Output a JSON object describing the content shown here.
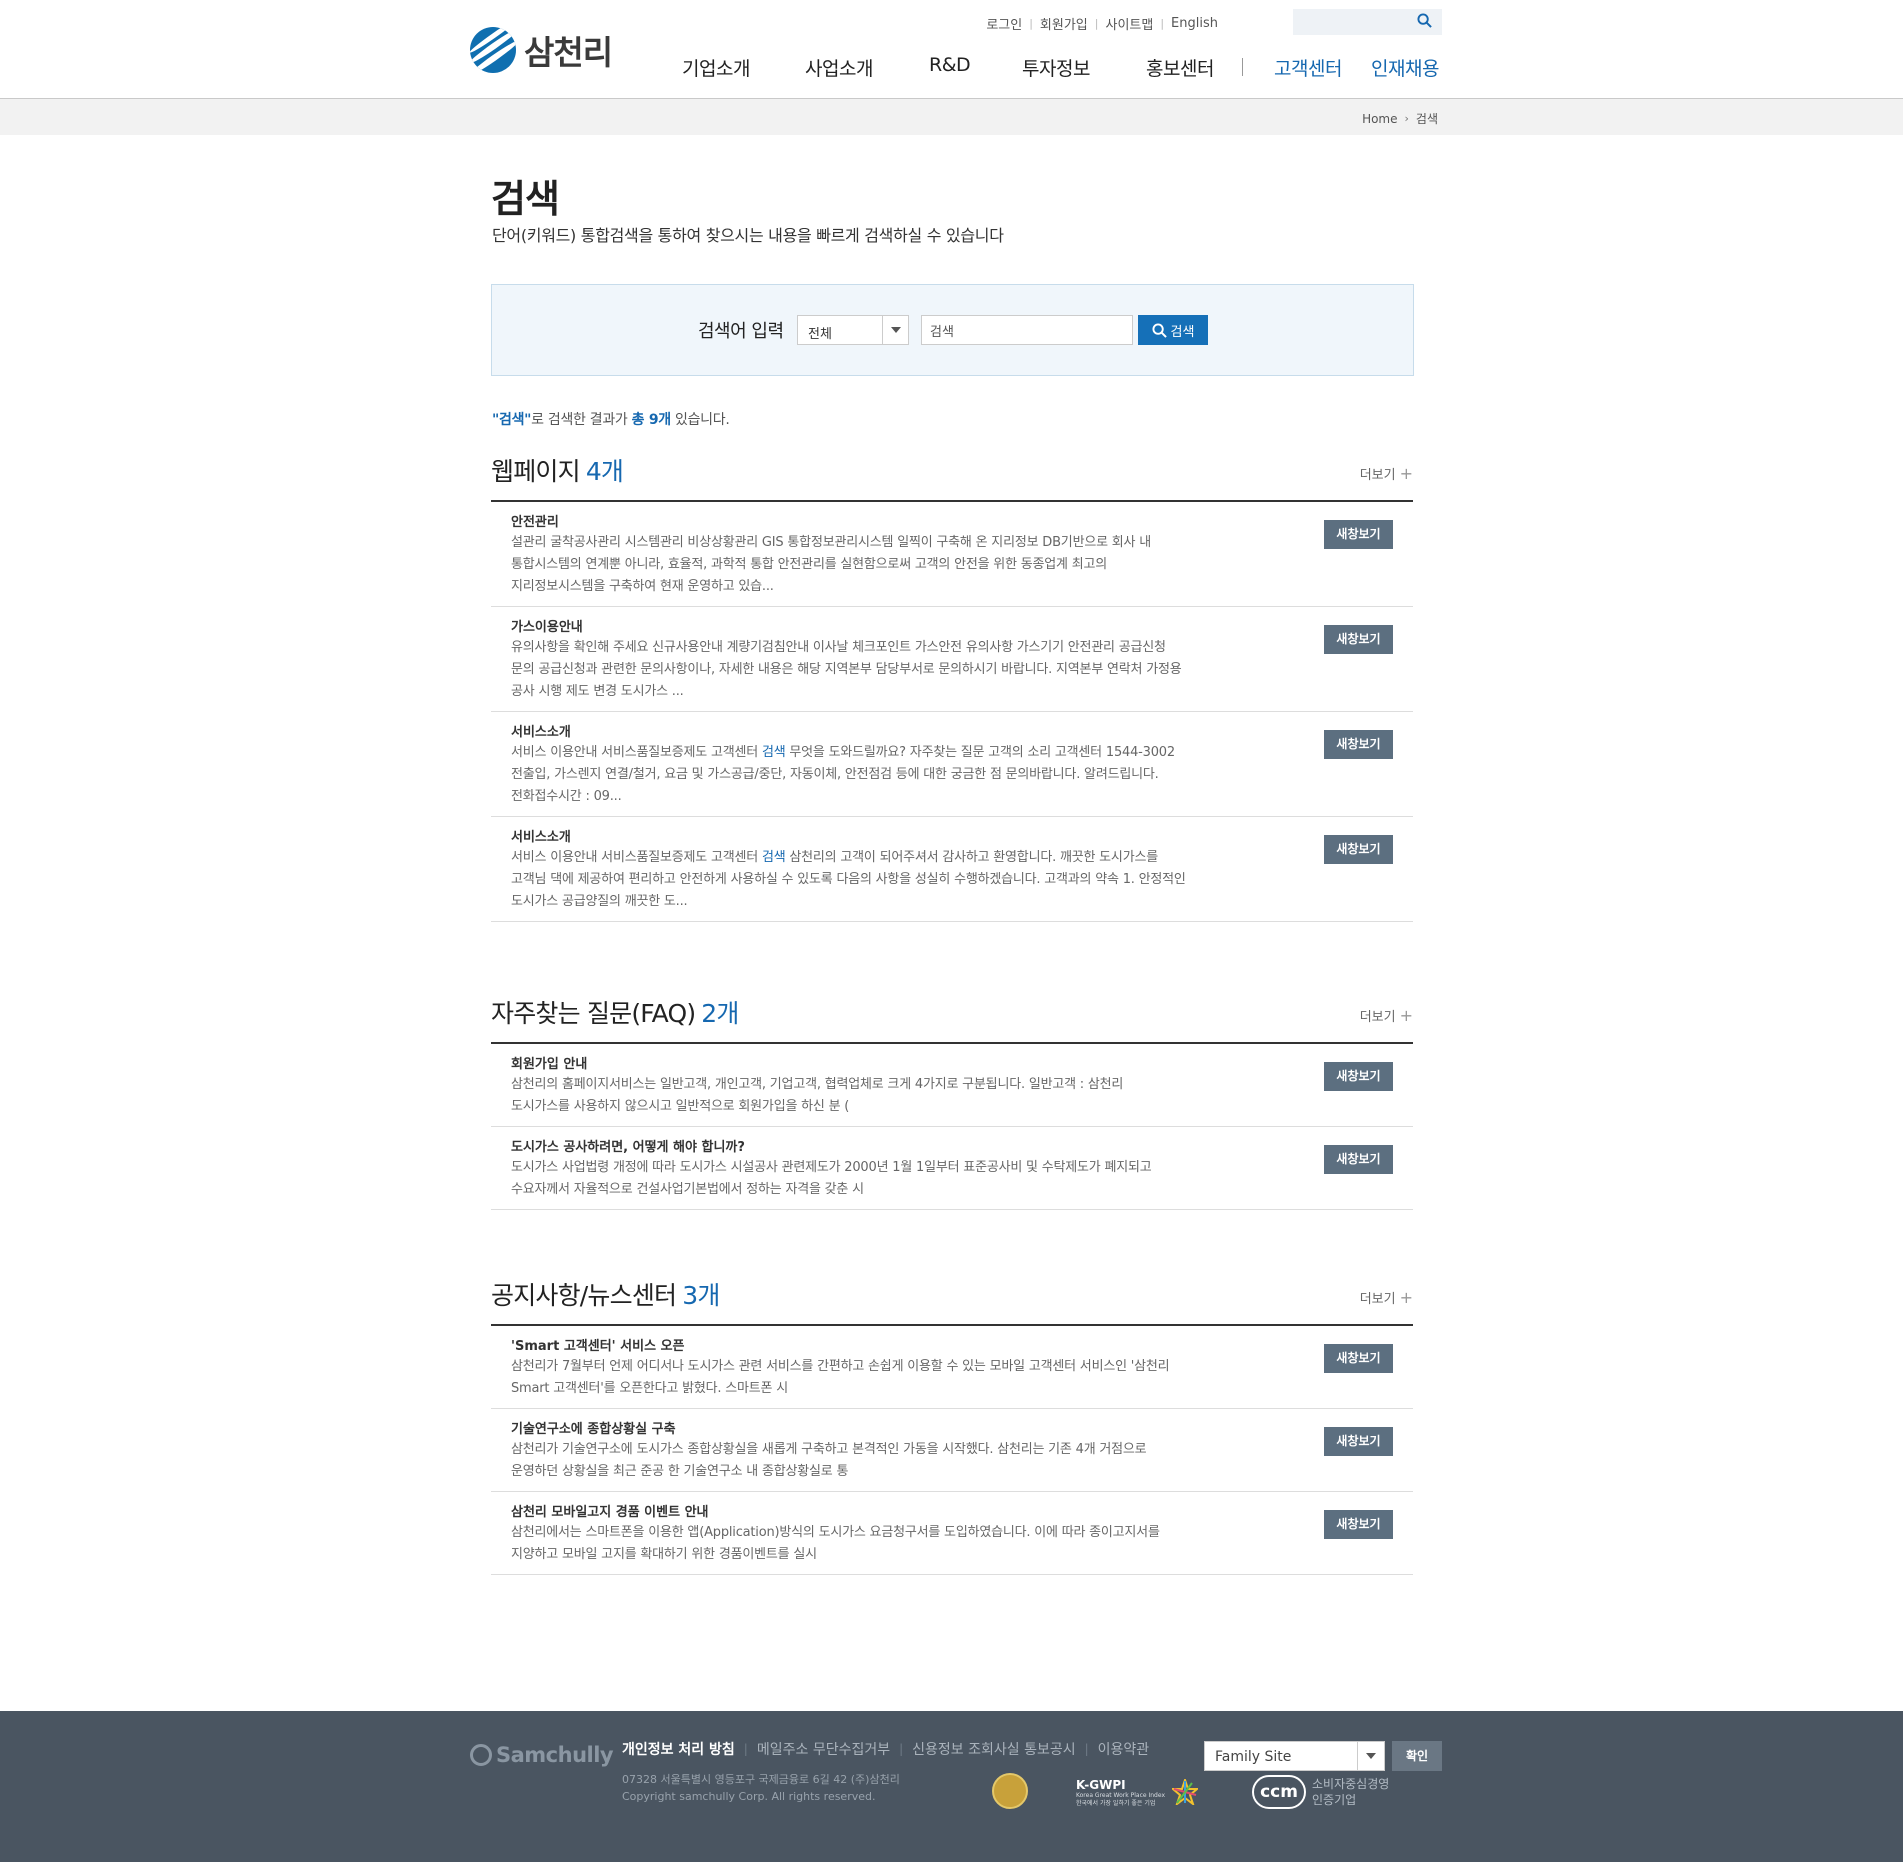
{
  "header": {
    "logo_text": "삼천리",
    "util_links": [
      "로그인",
      "회원가입",
      "사이트맵",
      "English"
    ],
    "gnb": [
      "기업소개",
      "사업소개",
      "R&D",
      "투자정보",
      "홍보센터",
      "고객센터",
      "인재채용"
    ]
  },
  "breadcrumb": {
    "home": "Home",
    "current": "검색"
  },
  "page": {
    "title": "검색",
    "description": "단어(키워드) 통합검색을 통하여 찾으시는 내용을 빠르게 검색하실 수 있습니다"
  },
  "search": {
    "label": "검색어 입력",
    "select_value": "전체",
    "input_value": "검색",
    "button_label": "검색"
  },
  "summary": {
    "keyword": "\"검색\"",
    "text1": "로 검색한 결과가 ",
    "total": "총 9개",
    "text2": " 있습니다."
  },
  "more_label": "더보기",
  "new_window_label": "새창보기",
  "sections": [
    {
      "title": "웹페이지",
      "count": "4개",
      "items": [
        {
          "title": "안전관리",
          "lines": [
            [
              "설관리 굴착공사관리 시스템관리 비상상황관리 GIS 통합정보관리시스템 일찍이 구축해 온 지리정보 DB기반으로 회사 내"
            ],
            [
              "통합시스템의 연계뿐 아니라, 효율적, 과학적 통합 안전관리를 실현함으로써 고객의 안전을 위한 동종업계 최고의"
            ],
            [
              "지리정보시스템을 구축하여 현재 운영하고 있습..."
            ]
          ]
        },
        {
          "title": "가스이용안내",
          "lines": [
            [
              "유의사항을 확인해 주세요 신규사용안내 계량기검침안내 이사날 체크포인트 가스안전 유의사항 가스기기 안전관리 공급신청"
            ],
            [
              "문의 공급신청과 관련한 문의사항이나, 자세한 내용은 해당 지역본부 담당부서로 문의하시기 바랍니다. 지역본부 연락처 가정용"
            ],
            [
              "공사 시행 제도 변경 도시가스 ..."
            ]
          ]
        },
        {
          "title": "서비스소개",
          "lines": [
            [
              "서비스 이용안내 서비스품질보증제도 고객센터 ",
              "검색",
              " 무엇을 도와드릴까요? 자주찾는 질문 고객의 소리 고객센터 1544-3002"
            ],
            [
              "전출입, 가스렌지 연결/철거, 요금 및 가스공급/중단, 자동이체, 안전점검 등에 대한 궁금한 점 문의바랍니다. 알려드립니다."
            ],
            [
              "전화접수시간 : 09..."
            ]
          ]
        },
        {
          "title": "서비스소개",
          "lines": [
            [
              "서비스 이용안내 서비스품질보증제도 고객센터 ",
              "검색",
              " 삼천리의 고객이 되어주셔서 감사하고 환영합니다. 깨끗한 도시가스를"
            ],
            [
              "고객님 댁에 제공하여 편리하고 안전하게 사용하실 수 있도록 다음의 사항을 성실히 수행하겠습니다. 고객과의 약속 1. 안정적인"
            ],
            [
              "도시가스 공급양질의 깨끗한 도..."
            ]
          ]
        }
      ]
    },
    {
      "title": "자주찾는 질문(FAQ)",
      "count": "2개",
      "items": [
        {
          "title": "회원가입 안내",
          "lines": [
            [
              "삼천리의 홈페이지서비스는 일반고객, 개인고객, 기업고객, 협력업체로 크게 4가지로 구분됩니다.   일반고객 : 삼천리"
            ],
            [
              "도시가스를 사용하지 않으시고 일반적으로 회원가입을 하신 분 ("
            ]
          ]
        },
        {
          "title": "도시가스 공사하려면, 어떻게 해야 합니까?",
          "lines": [
            [
              "도시가스 사업법령 개정에 따라 도시가스 시설공사 관련제도가 2000년 1월 1일부터 표준공사비 및 수탁제도가 폐지되고"
            ],
            [
              "수요자께서 자율적으로 건설사업기본법에서 정하는 자격을 갖춘 시"
            ]
          ]
        }
      ]
    },
    {
      "title": "공지사항/뉴스센터",
      "count": "3개",
      "items": [
        {
          "title": "'Smart 고객센터' 서비스 오픈",
          "lines": [
            [
              "삼천리가 7월부터 언제 어디서나 도시가스 관련 서비스를 간편하고 손쉽게 이용할 수 있는 모바일 고객센터 서비스인 '삼천리"
            ],
            [
              "Smart 고객센터'를 오픈한다고 밝혔다.   스마트폰 시"
            ]
          ]
        },
        {
          "title": "기술연구소에 종합상황실 구축",
          "lines": [
            [
              "삼천리가 기술연구소에 도시가스 종합상황실을 새롭게 구축하고 본격적인 가동을 시작했다.   삼천리는 기존 4개 거점으로"
            ],
            [
              "운영하던 상황실을 최근 준공 한 기술연구소 내 종합상황실로 통"
            ]
          ]
        },
        {
          "title": "삼천리 모바일고지 경품 이벤트 안내",
          "lines": [
            [
              "삼천리에서는 스마트폰을 이용한 앱(Application)방식의 도시가스 요금청구서를 도입하였습니다. 이에 따라 종이고지서를"
            ],
            [
              "지양하고 모바일 고지를 확대하기 위한 경품이벤트를 실시"
            ]
          ]
        }
      ]
    }
  ],
  "footer": {
    "logo_text": "Samchully",
    "links": [
      "개인정보 처리 방침",
      "메일주소 무단수집거부",
      "신용정보 조회사실 통보공시",
      "이용약관"
    ],
    "address": "07328 서울특별시 영등포구 국제금융로 6길 42 (주)삼천리",
    "copyright": "Copyright samchully Corp. All rights reserved.",
    "kgwpi_title": "K-GWPI",
    "kgwpi_sub1": "Korea Great Work Place Index",
    "kgwpi_sub2": "한국에서 가장 일하기 좋은 기업",
    "ccm_logo": "ccm",
    "ccm_line1": "소비자중심경영",
    "ccm_line2": "인증기업",
    "family_site": "Family Site",
    "confirm_label": "확인"
  },
  "colors": {
    "brand_blue": "#1668b0",
    "search_button": "#1570b8",
    "new_window_button": "#5c6f80",
    "footer_bg": "#4a5561"
  }
}
